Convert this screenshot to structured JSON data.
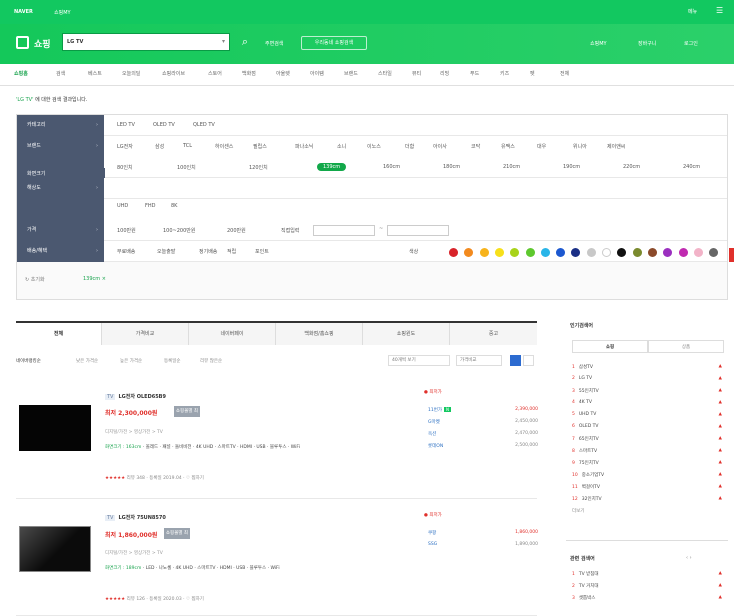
{
  "util_bar": {
    "left": [
      "NAVER",
      "쇼핑MY"
    ],
    "right": [
      "메뉴",
      "☰"
    ]
  },
  "header": {
    "logo": "쇼핑",
    "search_value": "LG TV",
    "near_search": "주변검색",
    "nearby_button": "우리동네 쇼핑검색",
    "links": [
      "쇼핑MY",
      "장바구니",
      "로그인"
    ]
  },
  "category_nav": [
    "쇼핑홈",
    "검색",
    "베스트",
    "오늘의딜",
    "쇼핑라이브",
    "스토어",
    "백화점",
    "아울렛",
    "아이템",
    "브랜드",
    "스타일",
    "뷰티",
    "리빙",
    "푸드",
    "키즈",
    "펫",
    "전체"
  ],
  "result_text": {
    "query": "'LG TV'",
    "suffix": "에 대한 검색 결과입니다."
  },
  "filters": [
    {
      "label": "카테고리",
      "options": [
        "LED TV",
        "OLED TV",
        "QLED TV"
      ]
    },
    {
      "label": "브랜드",
      "options": [
        "LG전자",
        "삼성",
        "TCL",
        "하이센스",
        "필립스",
        "파나소닉",
        "소니",
        "이노스",
        "더함",
        "아이사",
        "코닥",
        "유맥스",
        "대우",
        "위니아",
        "제이앤씨"
      ]
    },
    {
      "label": "화면크기",
      "options": [
        "80인치",
        "100인치",
        "120인치",
        "139cm",
        "160cm",
        "180cm",
        "210cm",
        "190cm",
        "220cm",
        "240cm"
      ],
      "active_index": 3
    },
    {
      "label": "해상도",
      "options": [
        "UHD",
        "FHD",
        "8K"
      ]
    },
    {
      "label": "가격",
      "options": [
        "100만원",
        "100~200만원",
        "200만원",
        "직접입력"
      ]
    },
    {
      "label": "배송/혜택",
      "options": [
        "무료배송",
        "오늘출발",
        "정기배송",
        "적립",
        "포인트"
      ],
      "color_label": "색상"
    }
  ],
  "swatch_colors": [
    "#d8232a",
    "#f28a1e",
    "#f7b31b",
    "#f7e01a",
    "#a8d319",
    "#5ec82e",
    "#29b5e8",
    "#1c58d0",
    "#1a2f86",
    "#c8c8c8",
    "#ffffff",
    "#111111",
    "#7a8a2e",
    "#8b4a2a",
    "#9b2fbf",
    "#c02ab0",
    "#f2b3c8",
    "#666666"
  ],
  "selected_bar": {
    "reset": "초기화",
    "chip": "139cm"
  },
  "tabs": [
    "전체",
    "가격비교",
    "네이버페이",
    "백화점/홈쇼핑",
    "쇼핑윈도",
    "중고"
  ],
  "tab_active": 0,
  "subbar": {
    "options": [
      "네이버랭킹순",
      "낮은 가격순",
      "높은 가격순",
      "등록일순",
      "리뷰 많은순"
    ],
    "controls": [
      "40개씩 보기",
      "가격비교"
    ]
  },
  "products": [
    {
      "tag": "TV",
      "title": "LG전자 OLED65B9",
      "price": "최저 2,300,000원",
      "compare": "쇼핑몰별 최저가",
      "category": "디지털/가전 > 영상가전 > TV",
      "spec_label": "화면크기 : 163cm",
      "spec": "올레드 · 패널 · 돌비비전 · 4K UHD · 스마트TV · HDMI · USB · 블루투스 · WiFi",
      "rating": "★★★★★",
      "reviews": "리뷰 348",
      "date": "등록일 2019.04",
      "wish": "찜하기",
      "mall_label": "최저가",
      "malls": [
        {
          "name": "11번가",
          "price": "2,390,000"
        },
        {
          "name": "G마켓",
          "price": "2,450,000"
        },
        {
          "name": "옥션",
          "price": "2,470,000"
        },
        {
          "name": "롯데ON",
          "price": "2,500,000"
        }
      ]
    },
    {
      "tag": "TV",
      "title": "LG전자 75UN8570",
      "price": "최저 1,860,000원",
      "compare": "쇼핑몰별 최저가",
      "category": "디지털/가전 > 영상가전 > TV",
      "spec_label": "화면크기 : 189cm",
      "spec": "LED · 나노셀 · 4K UHD · 스마트TV · HDMI · USB · 블루투스 · WiFi",
      "rating": "★★★★★",
      "reviews": "리뷰 126",
      "date": "등록일 2020.03",
      "wish": "찜하기",
      "mall_label": "최저가",
      "malls": [
        {
          "name": "쿠팡",
          "price": "1,860,000"
        },
        {
          "name": "SSG",
          "price": "1,890,000"
        }
      ]
    }
  ],
  "ranking": {
    "title": "인기검색어",
    "tabs": [
      "쇼핑",
      "상품"
    ],
    "items": [
      "삼성TV",
      "LG TV",
      "55인치TV",
      "4K TV",
      "UHD TV",
      "OLED TV",
      "65인치TV",
      "스마트TV",
      "75인치TV",
      "중소기업TV",
      "벽걸이TV",
      "32인치TV"
    ],
    "more": "더보기",
    "related_title": "관련 검색어",
    "related": [
      "TV 받침대",
      "TV 거치대",
      "셋톱박스"
    ]
  }
}
